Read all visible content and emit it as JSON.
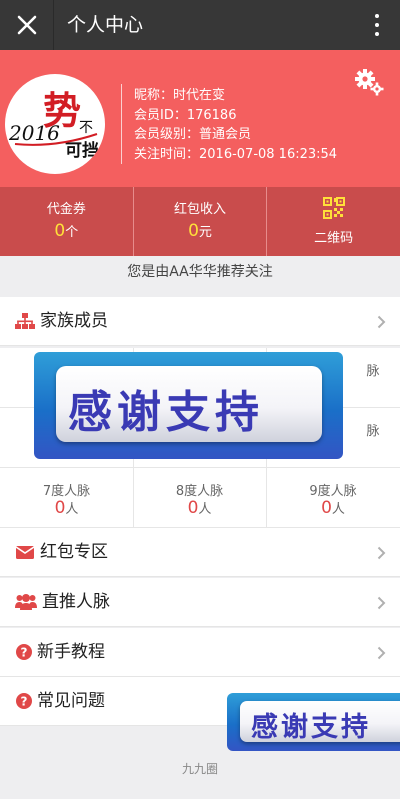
{
  "topbar": {
    "title": "个人中心"
  },
  "profile": {
    "avatar_text": {
      "year": "2016",
      "char": "势",
      "side1": "不",
      "side2": "可挡"
    },
    "nickname": "昵称：时代在变",
    "member_id": "会员ID：176186",
    "member_level": "会员级别：普通会员",
    "follow_time": "关注时间：2016-07-08 16:23:54"
  },
  "stats": {
    "voucher_label": "代金券",
    "voucher_value": "0",
    "voucher_unit": "个",
    "redpacket_label": "红包收入",
    "redpacket_value": "0",
    "redpacket_unit": "元",
    "qrcode_label": "二维码"
  },
  "referrer_text": "您是由AA华华推荐关注",
  "menu": {
    "family": "家族成员",
    "redpacket_zone": "红包专区",
    "direct": "直推人脉",
    "tutorial": "新手教程",
    "faq": "常见问题"
  },
  "network": {
    "row1_partial": "脉",
    "row2_partial": "脉",
    "cells": [
      {
        "label": "7度人脉",
        "value": "0",
        "unit": "人"
      },
      {
        "label": "8度人脉",
        "value": "0",
        "unit": "人"
      },
      {
        "label": "9度人脉",
        "value": "0",
        "unit": "人"
      }
    ]
  },
  "banner_text": "感谢支持",
  "banner2_text": "感谢支持",
  "footer_text": "九九圈",
  "colors": {
    "header_red": "#f45f5f",
    "stats_red": "#c94c4c",
    "accent_yellow": "#ffe03a",
    "value_red": "#e04848"
  }
}
